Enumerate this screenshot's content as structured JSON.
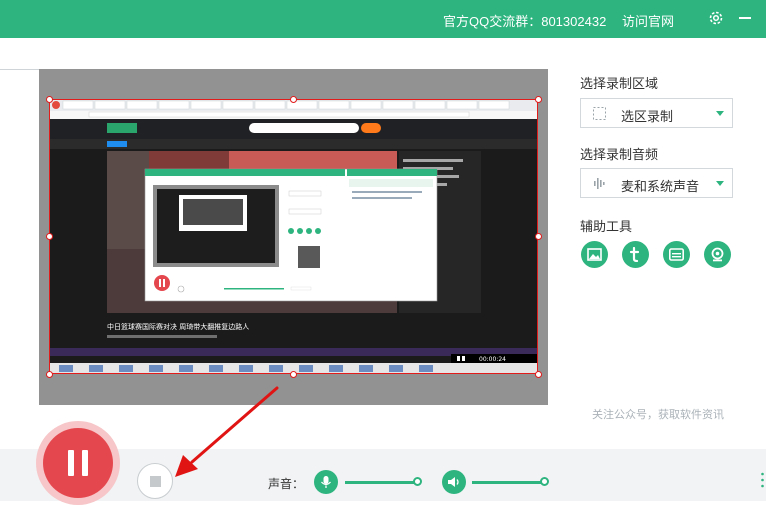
{
  "topbar": {
    "qq_group": "官方QQ交流群：801302432",
    "visit_site": "访问官网",
    "settings_icon": "gear-icon",
    "minimize_icon": "minimize-icon"
  },
  "panel": {
    "region_label": "选择录制区域",
    "region_value": "选区录制",
    "audio_label": "选择录制音频",
    "audio_value": "麦和系统声音",
    "tools_label": "辅助工具",
    "tools": [
      "image-icon",
      "text-icon",
      "subtitle-icon",
      "camera-icon"
    ],
    "follow_text": "关注公众号，获取软件资讯"
  },
  "bottom": {
    "sound_label": "声音：",
    "mic_level": 1.0,
    "speaker_level": 1.0
  },
  "preview": {
    "headline": "中日篮球赛国际赛对决 周琦带大翻推复边路人",
    "time": "00:00:24"
  },
  "colors": {
    "accent": "#2db47f",
    "record": "#e5474e",
    "selection": "#e21b1b"
  }
}
